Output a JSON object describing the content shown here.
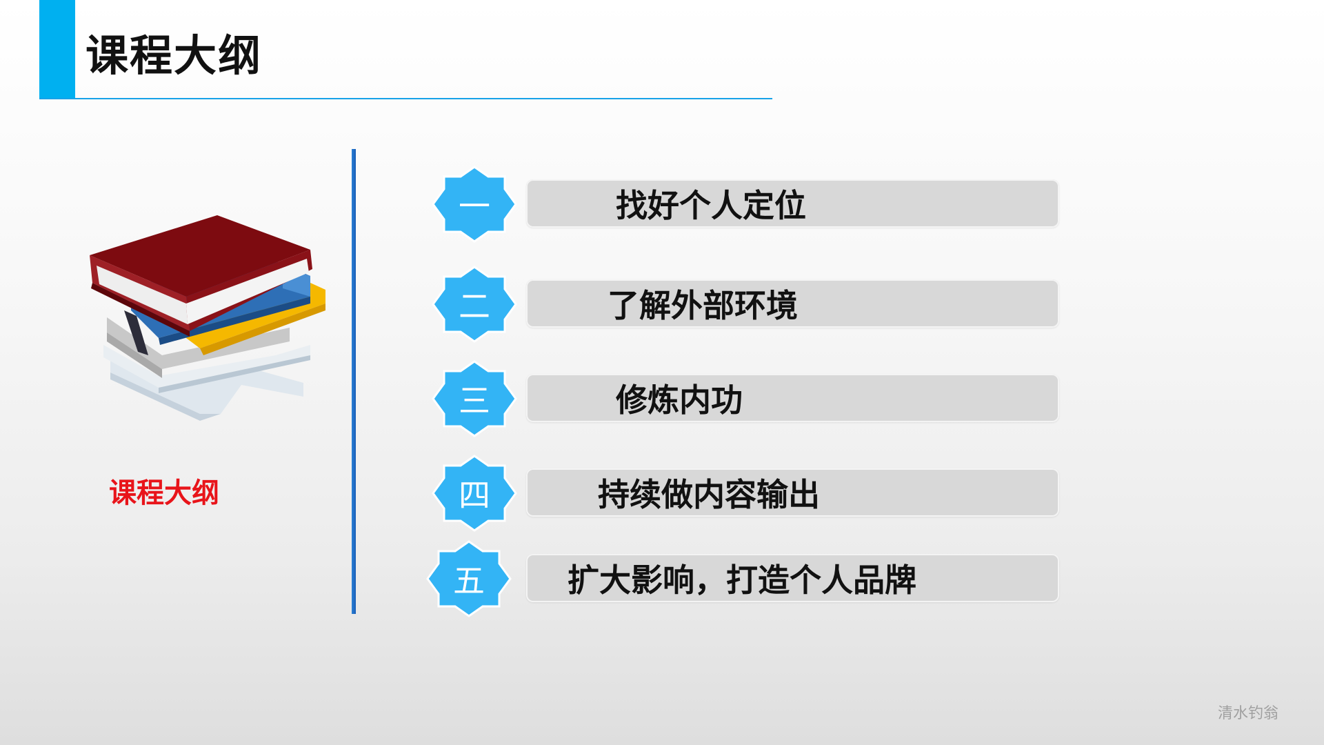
{
  "header": {
    "title": "课程大纲"
  },
  "side": {
    "caption": "课程大纲",
    "caption_color": "#e8141a",
    "illustration": "book-stack-icon"
  },
  "outline": {
    "badge_color": "#33b4f5",
    "items": [
      {
        "number": "一",
        "label": "找好个人定位"
      },
      {
        "number": "二",
        "label": "了解外部环境"
      },
      {
        "number": "三",
        "label": "修炼内功"
      },
      {
        "number": "四",
        "label": "持续做内容输出"
      },
      {
        "number": "五",
        "label": "扩大影响，打造个人品牌"
      }
    ]
  },
  "footer": {
    "watermark": "清水钓翁"
  },
  "colors": {
    "accent": "#00b0f0",
    "divider": "#1b5fb8",
    "pill": "#d8d8d8"
  }
}
